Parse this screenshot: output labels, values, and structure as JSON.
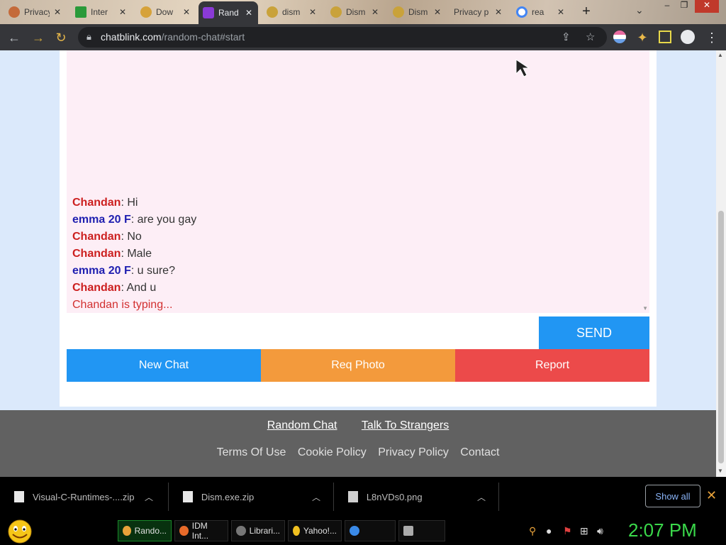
{
  "browser": {
    "tabs": [
      {
        "title": "Privacy -",
        "favicon_color": "#c46a3a",
        "active": false
      },
      {
        "title": "Inter",
        "favicon_color": "#2a9a3a",
        "active": false
      },
      {
        "title": "Dow",
        "favicon_color": "#d6a23a",
        "active": false
      },
      {
        "title": "Rand",
        "favicon_color": "#8a3ad6",
        "active": true
      },
      {
        "title": "dism",
        "favicon_color": "#c9a23a",
        "active": false
      },
      {
        "title": "Dism",
        "favicon_color": "#c9a23a",
        "active": false
      },
      {
        "title": "Dism",
        "favicon_color": "#c9a23a",
        "active": false
      },
      {
        "title": "Privacy p",
        "favicon_color": "#b0b0b0",
        "active": false
      },
      {
        "title": "rea",
        "favicon_color": "#4285f4",
        "active": false
      }
    ],
    "new_tab_symbol": "+",
    "url_domain": "chatblink.com",
    "url_path": "/random-chat#start"
  },
  "chat": {
    "messages": [
      {
        "name": "Chandan",
        "role": "me",
        "text": ": Hi"
      },
      {
        "name": "emma 20 F",
        "role": "other",
        "text": ": are you gay"
      },
      {
        "name": "Chandan",
        "role": "me",
        "text": ": No"
      },
      {
        "name": "Chandan",
        "role": "me",
        "text": ": Male"
      },
      {
        "name": "emma 20 F",
        "role": "other",
        "text": ": u sure?"
      },
      {
        "name": "Chandan",
        "role": "me",
        "text": ": And u"
      }
    ],
    "typing_status": "Chandan is typing...",
    "input_value": "",
    "send_label": "SEND",
    "new_chat_label": "New Chat",
    "req_photo_label": "Req Photo",
    "report_label": "Report"
  },
  "footer": {
    "primary_links": [
      "Random Chat",
      "Talk To Strangers"
    ],
    "secondary_links": [
      "Terms Of Use",
      "Cookie Policy",
      "Privacy Policy",
      "Contact"
    ]
  },
  "downloads": {
    "items": [
      {
        "file": "Visual-C-Runtimes-....zip"
      },
      {
        "file": "Dism.exe.zip"
      },
      {
        "file": "L8nVDs0.png"
      }
    ],
    "show_all_label": "Show all"
  },
  "taskbar": {
    "tasks": [
      {
        "label": "Rando...",
        "icon_color": "#e8a23a",
        "active": true
      },
      {
        "label": "IDM Int...",
        "icon_color": "#e86a2a",
        "active": false
      },
      {
        "label": "Librari...",
        "icon_color": "#777777",
        "active": false
      },
      {
        "label": "Yahoo!...",
        "icon_color": "#f0c020",
        "active": false
      },
      {
        "label": "",
        "icon_color": "#3a8ae8",
        "active": false
      },
      {
        "label": "",
        "icon_color": "#aaaaaa",
        "active": false
      }
    ],
    "clock": "2:07 PM"
  }
}
